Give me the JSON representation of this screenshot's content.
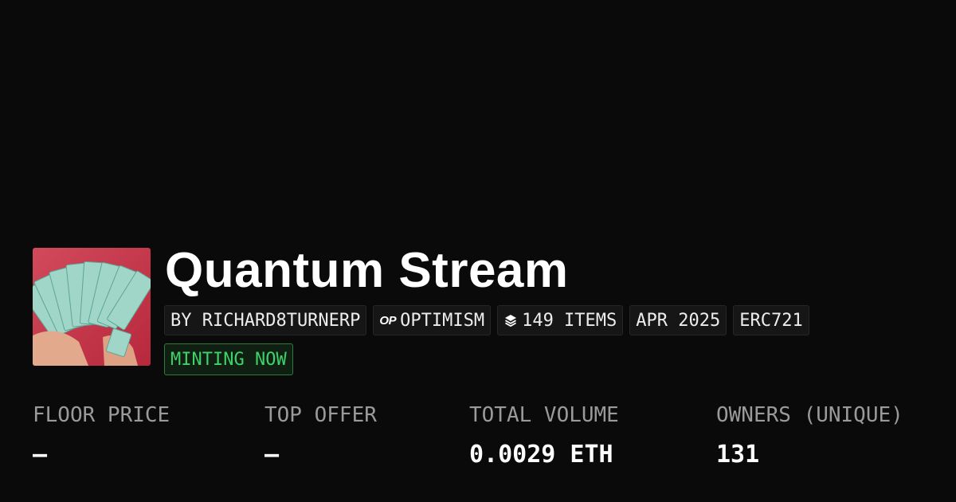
{
  "collection": {
    "name": "Quantum Stream",
    "thumbnail_icon": "banknotes-image"
  },
  "chips": {
    "creator": "BY RICHARD8TURNERP",
    "chain_icon": "optimism-op-icon",
    "chain_icon_text": "OP",
    "chain": "OPTIMISM",
    "items_icon": "layers-icon",
    "items": "149 ITEMS",
    "date": "APR 2025",
    "standard": "ERC721"
  },
  "status": {
    "label": "MINTING NOW",
    "color": "#3fd16a"
  },
  "stats": [
    {
      "label": "FLOOR PRICE",
      "value": "—"
    },
    {
      "label": "TOP OFFER",
      "value": "—"
    },
    {
      "label": "TOTAL VOLUME",
      "value": "0.0029 ETH"
    },
    {
      "label": "OWNERS (UNIQUE)",
      "value": "131"
    }
  ],
  "colors": {
    "background": "#0a0a0a",
    "chip_background": "#161616",
    "label": "#9a9a9a",
    "value": "#ffffff"
  }
}
